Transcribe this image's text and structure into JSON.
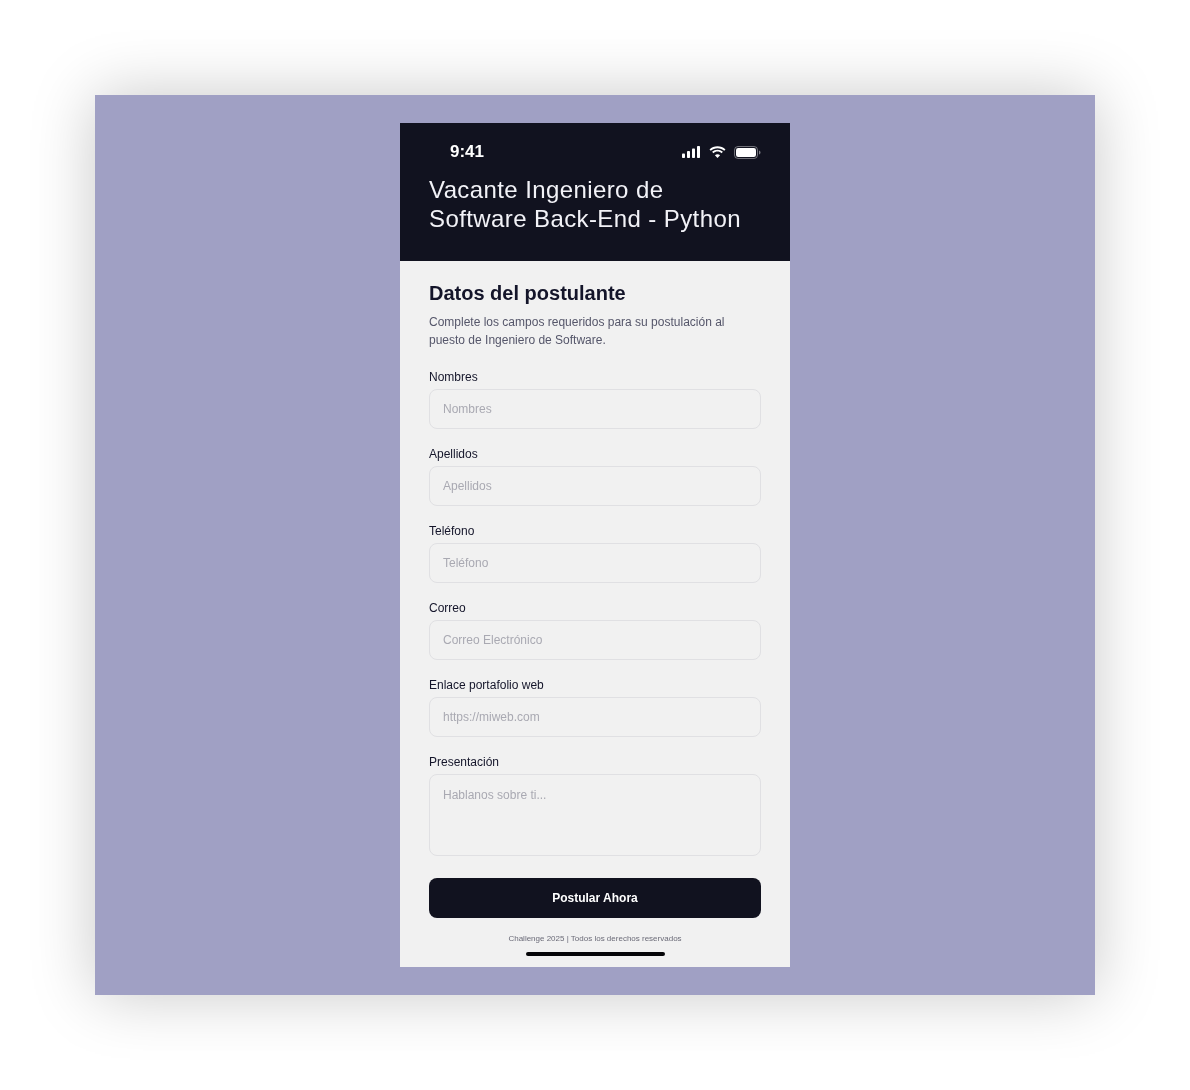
{
  "status_bar": {
    "time": "9:41"
  },
  "header": {
    "title": "Vacante Ingeniero de Software Back-End - Python"
  },
  "form": {
    "title": "Datos del postulante",
    "description": "Complete los campos requeridos para su postulación al puesto de Ingeniero de Software.",
    "fields": [
      {
        "kind": "input",
        "label": "Nombres",
        "placeholder": "Nombres"
      },
      {
        "kind": "input",
        "label": "Apellidos",
        "placeholder": "Apellidos"
      },
      {
        "kind": "input",
        "label": "Teléfono",
        "placeholder": "Teléfono"
      },
      {
        "kind": "input",
        "label": "Correo",
        "placeholder": "Correo Electrónico"
      },
      {
        "kind": "input",
        "label": "Enlace portafolio web",
        "placeholder": "https://miweb.com"
      },
      {
        "kind": "textarea",
        "label": "Presentación",
        "placeholder": "Hablanos sobre ti..."
      }
    ],
    "submit": "Postular Ahora"
  },
  "footer": "Challenge 2025 | Todos los derechos reservados"
}
